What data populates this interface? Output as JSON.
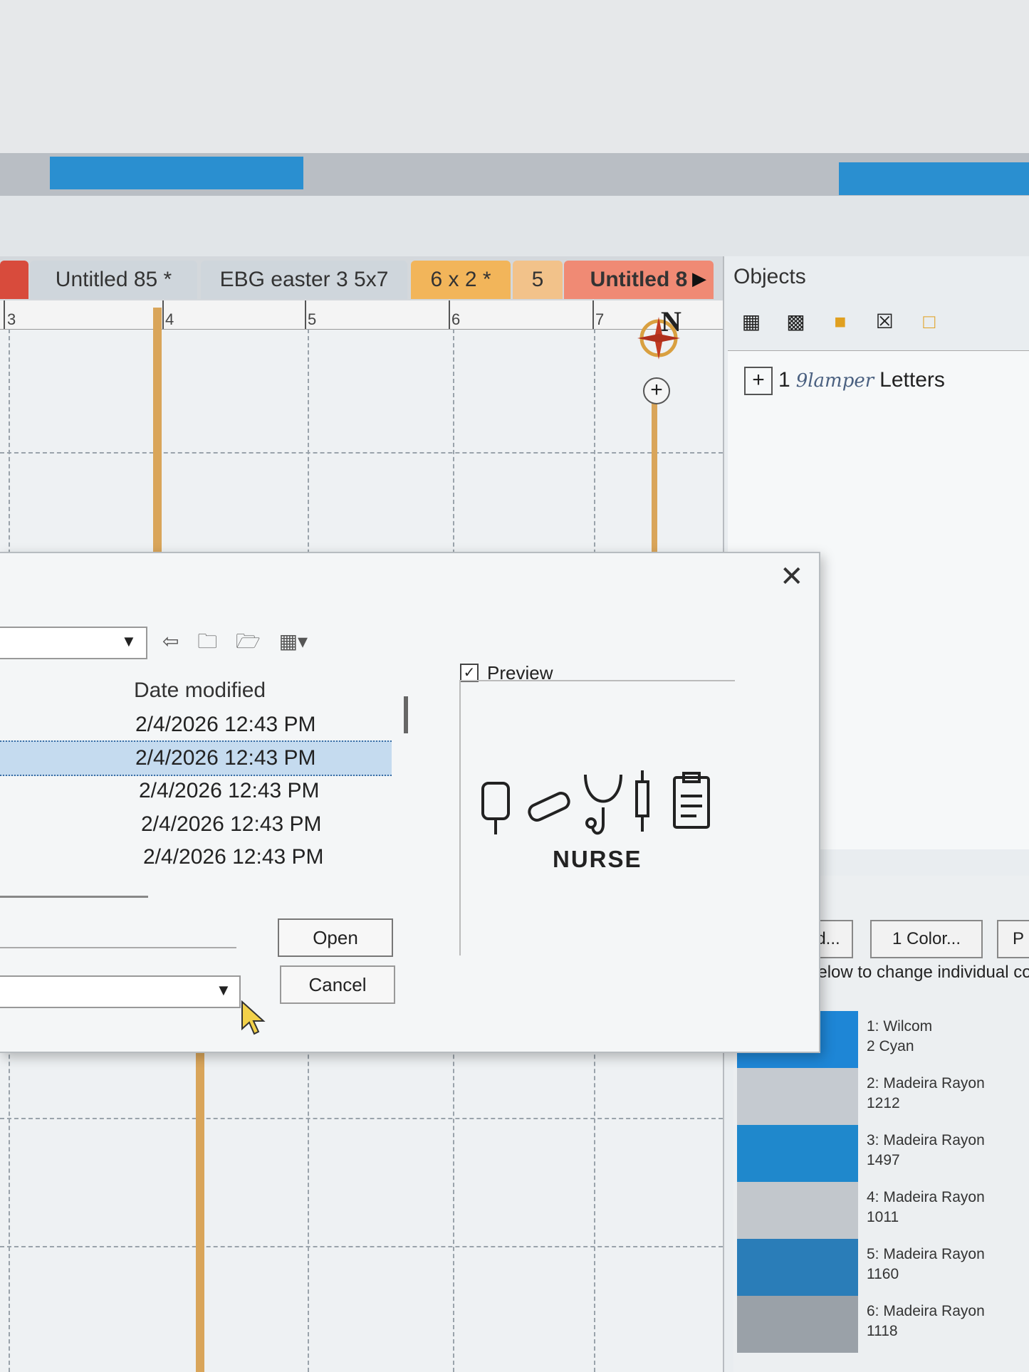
{
  "tabs": [
    {
      "label": ""
    },
    {
      "label": "Untitled 85 *"
    },
    {
      "label": "EBG easter 3 5x7"
    },
    {
      "label": "6 x 2 *"
    },
    {
      "label": "5"
    },
    {
      "label": "Untitled 8"
    }
  ],
  "tab_next_icon": "chevron-right-icon",
  "ruler": {
    "labels": [
      "3",
      "4",
      "5",
      "6",
      "7"
    ]
  },
  "compass": {
    "letter": "N"
  },
  "objects": {
    "title": "Objects",
    "tools": [
      "group-icon",
      "ungroup-icon",
      "lock-icon",
      "cross-box-icon",
      "unlock-icon"
    ],
    "items": [
      {
        "index": "1",
        "name": "Letters",
        "preview_text": "9lamper"
      }
    ]
  },
  "dialog": {
    "column_header": "Date modified",
    "files": [
      {
        "date": "2/4/2026 12:43 PM",
        "selected": false
      },
      {
        "date": "2/4/2026 12:43 PM",
        "selected": true
      },
      {
        "date": "2/4/2026 12:43 PM",
        "selected": false
      },
      {
        "date": "2/4/2026 12:43 PM",
        "selected": false
      },
      {
        "date": "2/4/2026 12:43 PM",
        "selected": false
      }
    ],
    "preview_checked": true,
    "preview_label": "Preview",
    "preview_text": "NURSE",
    "open_label": "Open",
    "cancel_label": "Cancel",
    "close_icon": "close-icon"
  },
  "colors": {
    "button_d": "d...",
    "button_colors": "1 Color...",
    "button_p": "P",
    "hint": "below to change individual co",
    "items": [
      {
        "line1": "1: Wilcom",
        "line2": "2 Cyan",
        "color": "#1e86d6"
      },
      {
        "line1": "2: Madeira Rayon",
        "line2": "1212",
        "color": "#c5cad0"
      },
      {
        "line1": "3: Madeira Rayon",
        "line2": "1497",
        "color": "#1f88cc"
      },
      {
        "line1": "4: Madeira Rayon",
        "line2": "1011",
        "color": "#c2c7cc"
      },
      {
        "line1": "5: Madeira Rayon",
        "line2": "1160",
        "color": "#2a7db8"
      },
      {
        "line1": "6: Madeira Rayon",
        "line2": "1118",
        "color": "#9aa1a8"
      }
    ]
  },
  "accent_colors": {
    "blue_bar": "#2a8fd0",
    "hoop": "#d9a55a"
  }
}
